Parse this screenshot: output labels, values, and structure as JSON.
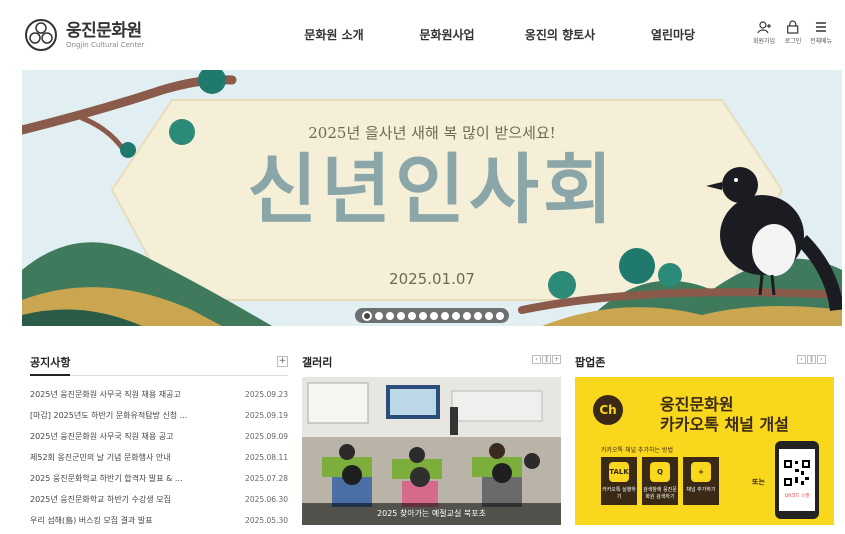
{
  "header": {
    "logo_ko": "웅진문화원",
    "logo_en": "Ongjin Cultural Center",
    "nav": [
      "문화원 소개",
      "문화원사업",
      "옹진의 향토사",
      "열린마당"
    ],
    "utils": [
      {
        "icon": "user-icon",
        "label": "회원가입"
      },
      {
        "icon": "lock-icon",
        "label": "로그인"
      },
      {
        "icon": "menu-icon",
        "label": "전체메뉴"
      }
    ]
  },
  "banner": {
    "subtitle": "2025년 을사년 새해 복 많이 받으세요!",
    "title": "신년인사회",
    "date": "2025.01.07",
    "slides_total": 13,
    "active_slide": 1
  },
  "notice": {
    "title": "공지사항",
    "items": [
      {
        "title": "2025년 웅진문화원 사무국 직원 채용 재공고",
        "date": "2025.09.23"
      },
      {
        "title": "[마감] 2025년도 하반기 문화유적탐방 신청 ...",
        "date": "2025.09.19"
      },
      {
        "title": "2025년 웅진문화원 사무국 직원 채용 공고",
        "date": "2025.09.09"
      },
      {
        "title": "제52회 옹진군민의 날 기념 문화행사 안내",
        "date": "2025.08.11"
      },
      {
        "title": "2025 웅진문화학교 하반기 합격자 발표 & ...",
        "date": "2025.07.28"
      },
      {
        "title": "2025년 웅진문화학교 하반기 수강생 모집",
        "date": "2025.06.30"
      },
      {
        "title": "우리 섬해(島) 버스킹 모집 결과 발표",
        "date": "2025.05.30"
      }
    ]
  },
  "gallery": {
    "title": "갤러리",
    "caption": "2025 찾아가는 예절교실 북포초"
  },
  "popup": {
    "title": "팝업존",
    "line1": "웅진문화원",
    "line2": "카카오톡 채널 개설",
    "how": "카카오톡 채널 추가하는 방법",
    "steps": [
      {
        "icon": "TALK",
        "label": "카카오톡 실행하기"
      },
      {
        "icon": "Q",
        "label": "검색창에 웅진문화원 검색하기"
      },
      {
        "icon": "+",
        "label": "채널 추가하기"
      }
    ],
    "or": "또는",
    "qr_label": "QR코드 스캔"
  },
  "colors": {
    "banner_bg": "#dfeef1",
    "title_text": "#8aa6a8",
    "popup_bg": "#f9d71c",
    "kakao_brown": "#3a2a15"
  }
}
